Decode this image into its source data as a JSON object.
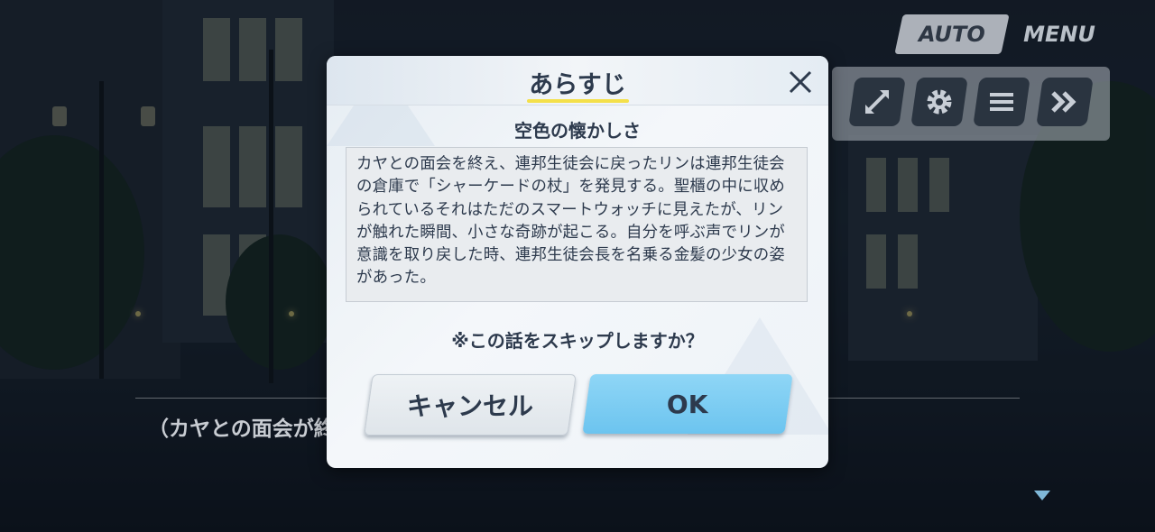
{
  "controls": {
    "auto_label": "AUTO",
    "menu_label": "MENU",
    "icons": [
      "expand-icon",
      "gear-icon",
      "list-icon",
      "fast-forward-icon"
    ]
  },
  "dialogue": {
    "text": "（カヤとの面会が終"
  },
  "modal": {
    "title": "あらすじ",
    "story_title": "空色の懐かしさ",
    "summary_lines": [
      "カヤとの面会を終え、連邦生徒会に戻ったリンは連邦生徒会",
      "の倉庫で「シャーケードの杖」を発見する。聖櫃の中に収め",
      "られているそれはただのスマートウォッチに見えたが、リン",
      "が触れた瞬間、小さな奇跡が起こる。自分を呼ぶ声でリンが",
      "意識を取り戻した時、連邦生徒会長を名乗る金髪の少女の姿",
      "があった。"
    ],
    "skip_question": "※この話をスキップしますか？",
    "cancel_label": "キャンセル",
    "ok_label": "OK"
  },
  "colors": {
    "ok_button": "#6cc4ef",
    "title_underline": "#f4e04a",
    "text": "#2d3a4d"
  }
}
